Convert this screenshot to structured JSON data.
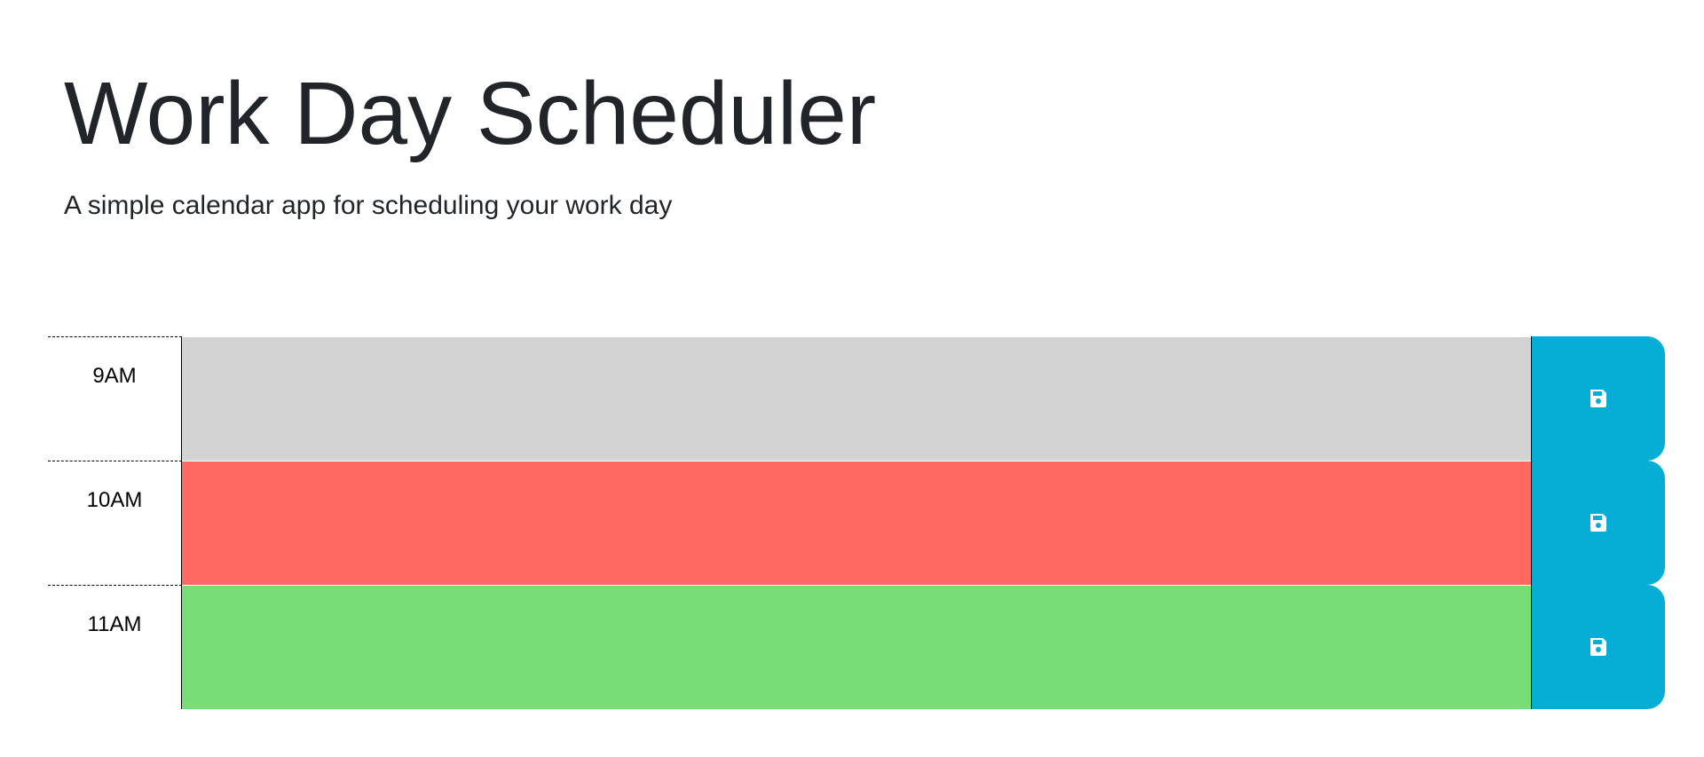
{
  "header": {
    "title": "Work Day Scheduler",
    "lead": "A simple calendar app for scheduling your work day"
  },
  "timeblocks": [
    {
      "hour": "9AM",
      "description": "",
      "state": "past"
    },
    {
      "hour": "10AM",
      "description": "",
      "state": "present"
    },
    {
      "hour": "11AM",
      "description": "",
      "state": "future"
    }
  ],
  "colors": {
    "past": "#d3d3d3",
    "present": "#ff6961",
    "future": "#77dd77",
    "save_button": "#06aed5",
    "text": "#212529"
  },
  "icons": {
    "save": "floppy-disk-icon"
  }
}
